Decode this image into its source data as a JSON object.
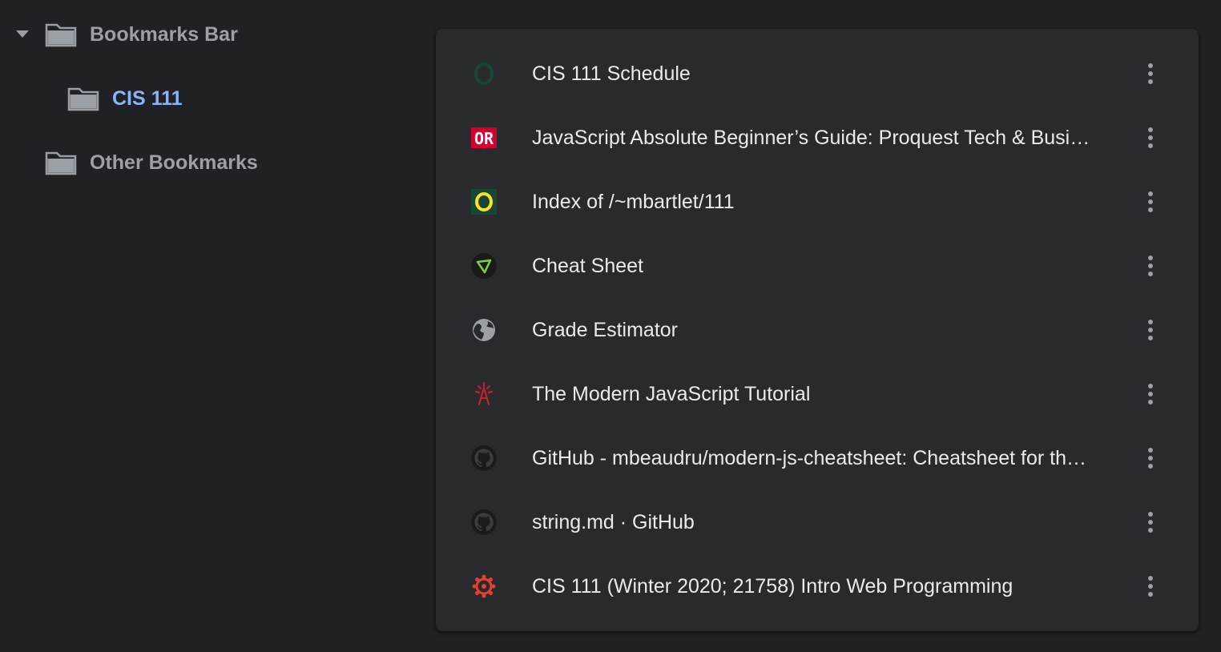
{
  "tree": {
    "bookmarks_bar": "Bookmarks Bar",
    "cis111": "CIS 111",
    "other_bookmarks": "Other Bookmarks"
  },
  "items": [
    {
      "title": "CIS 111 Schedule",
      "icon": "uo-o-green-icon"
    },
    {
      "title": "JavaScript Absolute Beginner’s Guide: Proquest Tech & Business Books",
      "icon": "oreilly-icon"
    },
    {
      "title": "Index of /~mbartlet/111",
      "icon": "uo-o-yellow-icon"
    },
    {
      "title": "Cheat Sheet",
      "icon": "cheatsheet-icon"
    },
    {
      "title": "Grade Estimator",
      "icon": "globe-icon"
    },
    {
      "title": "The Modern JavaScript Tutorial",
      "icon": "tower-icon"
    },
    {
      "title": "GitHub - mbeaudru/modern-js-cheatsheet: Cheatsheet for the JavaScript knowledge you will frequently encounter in modern projects.",
      "icon": "github-icon"
    },
    {
      "title": "string.md · GitHub",
      "icon": "github-icon"
    },
    {
      "title": "CIS 111 (Winter 2020; 21758) Intro Web Programming",
      "icon": "canvas-icon"
    }
  ],
  "colors": {
    "background": "#202124",
    "card": "#292a2d",
    "text": "#e8eaed",
    "muted": "#9aa0a6",
    "selected": "#8ab4f8"
  }
}
